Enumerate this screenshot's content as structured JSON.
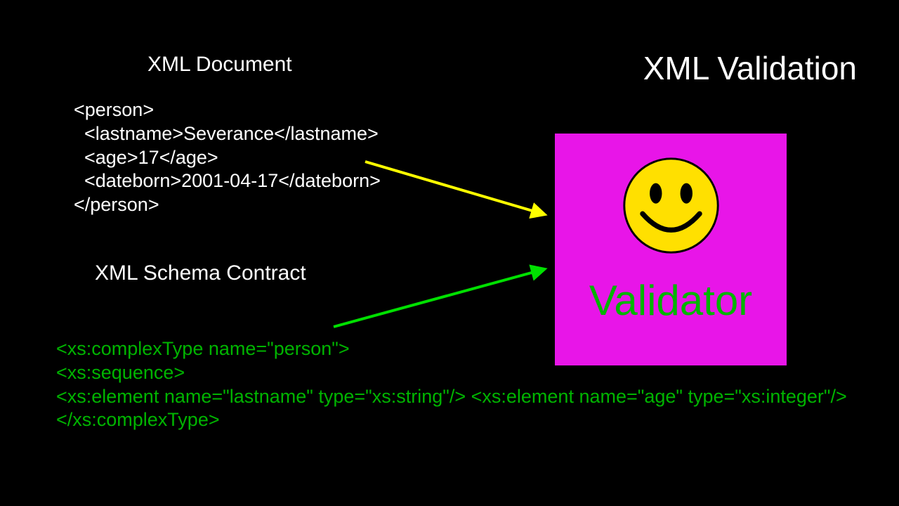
{
  "title": "XML Validation",
  "section1_heading": "XML Document",
  "xml_lines": {
    "l1": "<person>",
    "l2": "  <lastname>Severance</lastname>",
    "l3": "  <age>17</age>",
    "l4": "  <dateborn>2001-04-17</dateborn>",
    "l5": "</person>"
  },
  "section2_heading": "XML Schema Contract",
  "schema_lines": {
    "l1": "<xs:complexType name=\"person\">",
    "l2": "  <xs:sequence>",
    "l3": "   <xs:element name=\"lastname\" type=\"xs:string\"/>   <xs:element name=\"age\" type=\"xs:integer\"/>",
    "l4": "</xs:complexType>"
  },
  "validator_label": "Validator"
}
